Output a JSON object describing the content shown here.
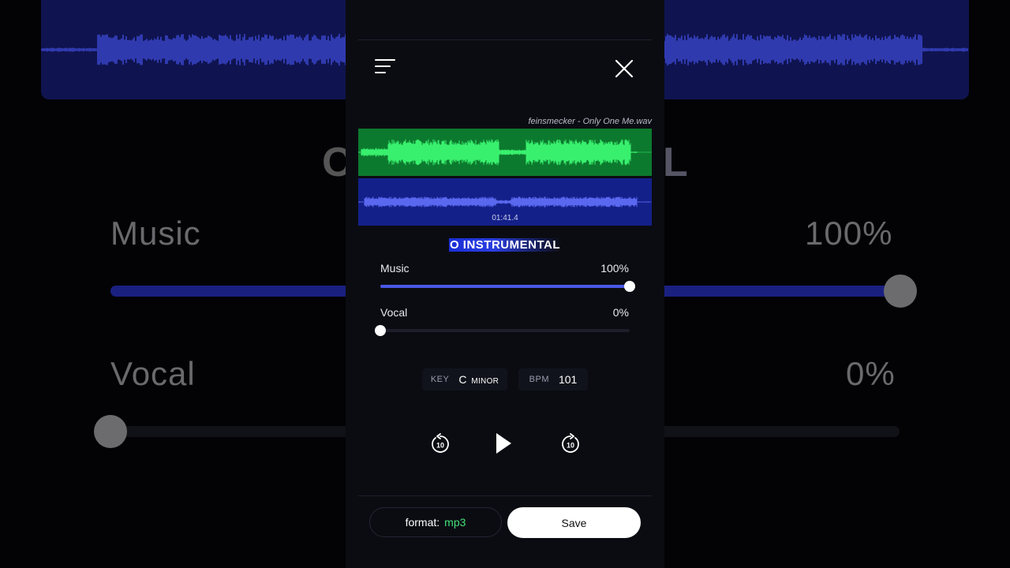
{
  "app": {
    "menu_icon": "hamburger-menu-icon",
    "close_icon": "close-icon",
    "file_name": "feinsmecker - Only One Me.wav"
  },
  "waveform": {
    "vocal_color": "#0c7a2e",
    "vocal_wave_color": "#39f06e",
    "music_color": "#14208a",
    "music_wave_color": "#5a68f0",
    "timecode": "01:41.4"
  },
  "mode": {
    "title": "O INSTRUMENTAL"
  },
  "mixer": {
    "music": {
      "label": "Music",
      "value_text": "100%",
      "level": 1.0
    },
    "vocal": {
      "label": "Vocal",
      "value_text": "0%",
      "level": 0.0
    }
  },
  "info": {
    "key_label": "KEY",
    "key_note": "C",
    "key_scale": "MINOR",
    "bpm_label": "BPM",
    "bpm_value": "101"
  },
  "transport": {
    "rewind_icon": "rewind-10-icon",
    "rewind_seconds": "10",
    "play_icon": "play-icon",
    "forward_icon": "forward-10-icon",
    "forward_seconds": "10"
  },
  "footer": {
    "format_label": "format:",
    "format_value": "mp3",
    "save_label": "Save"
  },
  "colors": {
    "panel_bg": "#0b0c12",
    "accent": "#4a58e6",
    "format_value": "#45e07a"
  }
}
